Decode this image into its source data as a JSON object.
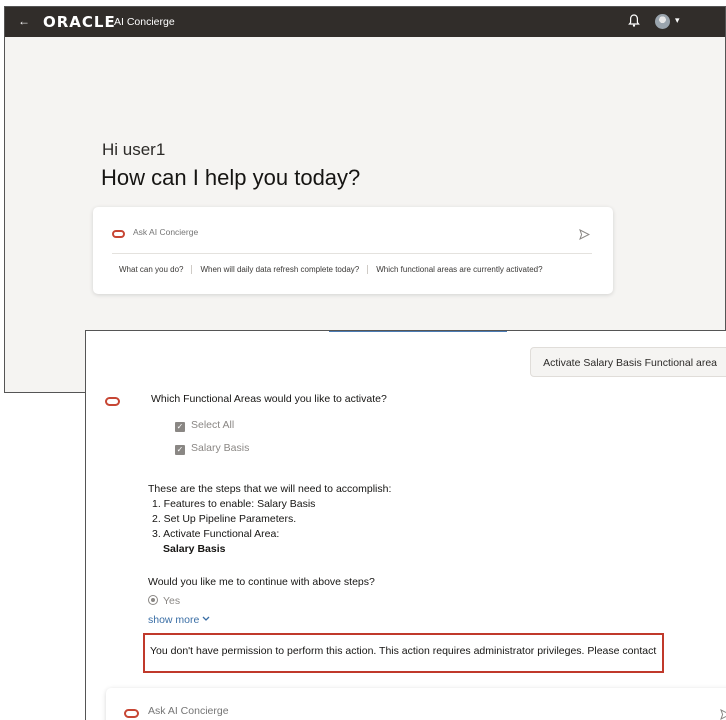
{
  "header": {
    "back_glyph": "←",
    "logo": "ORACLE",
    "app_title": "AI Concierge",
    "icons": {
      "notifications": "bell-icon",
      "user": "avatar-icon",
      "menu": "chevron-down-icon"
    }
  },
  "home": {
    "greeting": "Hi user1",
    "headline": "How can I help you today?",
    "input_placeholder": "Ask AI Concierge",
    "suggestions": [
      "What can you do?",
      "When will daily data refresh complete today?",
      "Which functional areas are currently activated?"
    ]
  },
  "chat": {
    "user_message": "Activate Salary Basis Functional area",
    "bot_question": "Which Functional Areas would you like to activate?",
    "options": [
      {
        "label": "Select All",
        "checked": true
      },
      {
        "label": "Salary Basis",
        "checked": true
      }
    ],
    "steps_intro": "These are the steps that we will need to accomplish:",
    "steps": [
      "1. Features to enable: Salary Basis",
      "2. Set Up Pipeline Parameters.",
      "3. Activate Functional Area:"
    ],
    "step3_detail": "Salary Basis",
    "continue_question": "Would you like me to continue with above steps?",
    "yes_label": "Yes",
    "show_more": "show more",
    "error_message": "You don't have permission to perform this action. This action requires administrator privileges. Please contact",
    "input_placeholder": "Ask AI Concierge"
  },
  "colors": {
    "header_bg": "#312d2a",
    "oracle_red": "#c74634",
    "error_border": "#c0392b",
    "link": "#3a6ea5"
  }
}
